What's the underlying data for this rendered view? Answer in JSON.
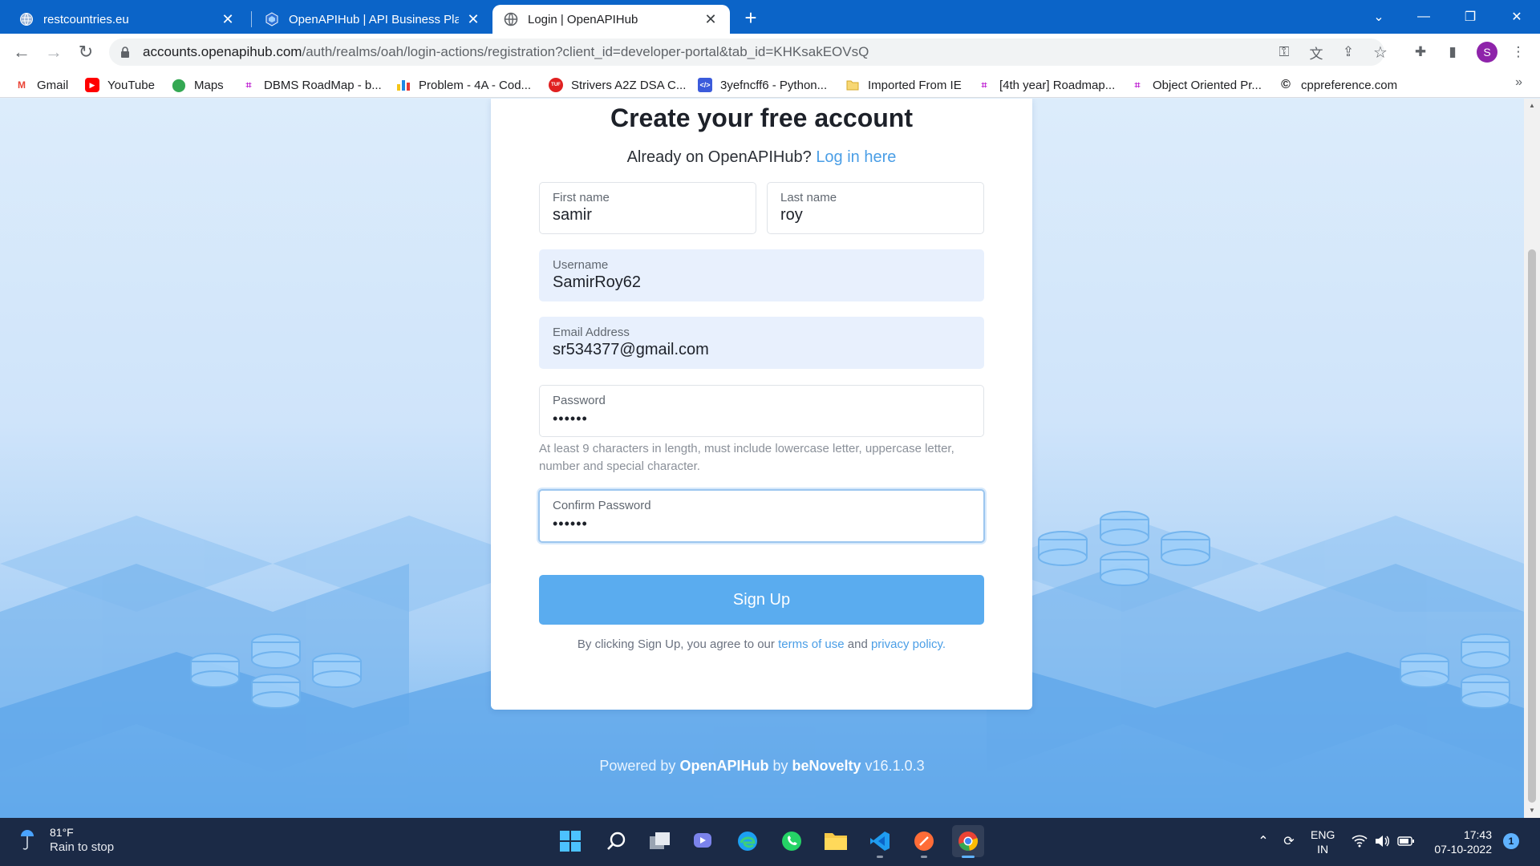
{
  "browser": {
    "tabs": [
      {
        "title": "restcountries.eu",
        "active": false
      },
      {
        "title": "OpenAPIHub | API Business Platform",
        "active": false
      },
      {
        "title": "Login | OpenAPIHub",
        "active": true
      }
    ],
    "url_host": "accounts.openapihub.com",
    "url_path": "/auth/realms/oah/login-actions/registration?client_id=developer-portal&tab_id=KHKsakEOVsQ",
    "profile_initial": "S",
    "bookmarks": [
      {
        "label": "Gmail",
        "icon": "gmail-icon"
      },
      {
        "label": "YouTube",
        "icon": "youtube-icon"
      },
      {
        "label": "Maps",
        "icon": "maps-icon"
      },
      {
        "label": "DBMS RoadMap - b...",
        "icon": "roadmap-icon"
      },
      {
        "label": "Problem - 4A - Cod...",
        "icon": "codeforces-icon"
      },
      {
        "label": "Strivers A2Z DSA C...",
        "icon": "tuf-icon"
      },
      {
        "label": "3yefncff6 - Python...",
        "icon": "code-icon"
      },
      {
        "label": "Imported From IE",
        "icon": "folder-icon"
      },
      {
        "label": "[4th year] Roadmap...",
        "icon": "roadmap-icon"
      },
      {
        "label": "Object Oriented Pr...",
        "icon": "roadmap-icon"
      },
      {
        "label": "cppreference.com",
        "icon": "cppreference-icon"
      }
    ],
    "bookmarks_more": "»"
  },
  "form": {
    "title": "Create your free account",
    "already_text": "Already on OpenAPIHub?",
    "login_link": "Log in here",
    "first_name": {
      "label": "First name",
      "value": "samir"
    },
    "last_name": {
      "label": "Last name",
      "value": "roy"
    },
    "username": {
      "label": "Username",
      "value": "SamirRoy62"
    },
    "email": {
      "label": "Email Address",
      "value": "sr534377@gmail.com"
    },
    "password": {
      "label": "Password",
      "value": "••••••"
    },
    "password_hint": "At least 9 characters in length, must include lowercase letter, uppercase letter, number and special character.",
    "confirm_password": {
      "label": "Confirm Password",
      "value": "••••••"
    },
    "signup_button": "Sign Up",
    "terms_prefix": "By clicking Sign Up, you agree to our",
    "terms_link": "terms of use",
    "terms_and": "and",
    "privacy_link": "privacy policy."
  },
  "footer": {
    "powered_by": "Powered by",
    "brand": "OpenAPIHub",
    "by": "by",
    "company": "beNovelty",
    "version": "v16.1.0.3"
  },
  "taskbar": {
    "weather_temp": "81°F",
    "weather_desc": "Rain to stop",
    "lang": "ENG",
    "region": "IN",
    "time": "17:43",
    "date": "07-10-2022",
    "notification_count": "1"
  },
  "colors": {
    "accent": "#5aacef",
    "link": "#4a9ee6",
    "chrome_titlebar": "#0b64c8",
    "taskbar": "#1b2a46"
  }
}
